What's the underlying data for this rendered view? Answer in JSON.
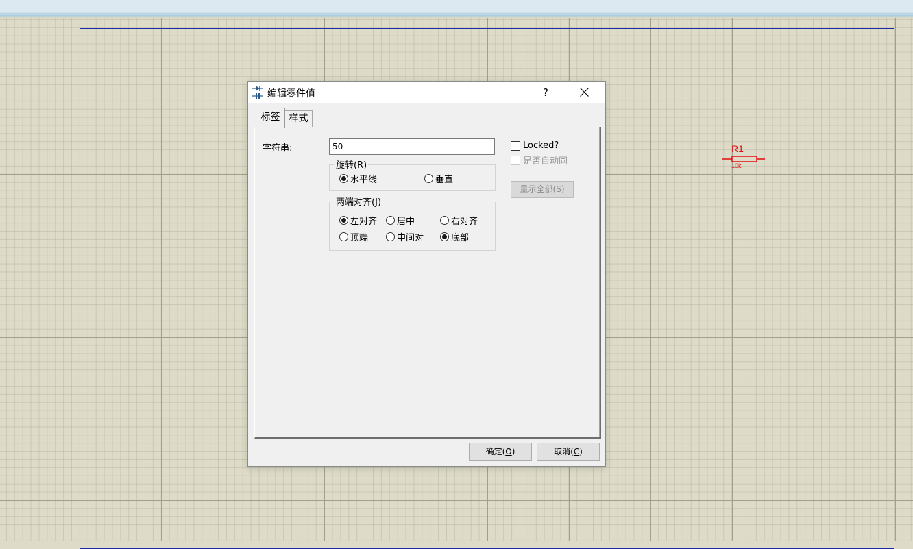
{
  "schematic": {
    "component": {
      "reference": "R1",
      "value": "10k"
    },
    "colors": {
      "grid_background": "#dedcc8",
      "sheet_border": "#1c2aa8",
      "component": "#e01010"
    }
  },
  "dialog": {
    "title": "编辑零件值",
    "help_label": "?",
    "tabs": [
      {
        "label": "标签",
        "selected": true
      },
      {
        "label": "样式",
        "selected": false
      }
    ],
    "string_label": "字符串:",
    "string_value": "50",
    "rotation": {
      "title": "旋转",
      "hotkey": "R",
      "options": [
        {
          "label": "水平线",
          "checked": true
        },
        {
          "label": "垂直",
          "checked": false
        }
      ]
    },
    "justify": {
      "title": "两端对齐",
      "hotkey": "J",
      "horizontal": [
        {
          "label": "左对齐",
          "checked": true
        },
        {
          "label": "居中",
          "checked": false
        },
        {
          "label": "右对齐",
          "checked": false
        }
      ],
      "vertical": [
        {
          "label": "顶端",
          "checked": false
        },
        {
          "label": "中间对",
          "checked": false
        },
        {
          "label": "底部",
          "checked": true
        }
      ]
    },
    "locked": {
      "hotkey": "L",
      "rest": "ocked?",
      "checked": false
    },
    "auto_sync": {
      "label": "是否自动同",
      "checked": false,
      "disabled": true
    },
    "show_all": {
      "label": "显示全部",
      "hotkey": "S",
      "disabled": true
    },
    "ok": {
      "label": "确定",
      "hotkey": "O"
    },
    "cancel": {
      "label": "取消",
      "hotkey": "C"
    }
  }
}
